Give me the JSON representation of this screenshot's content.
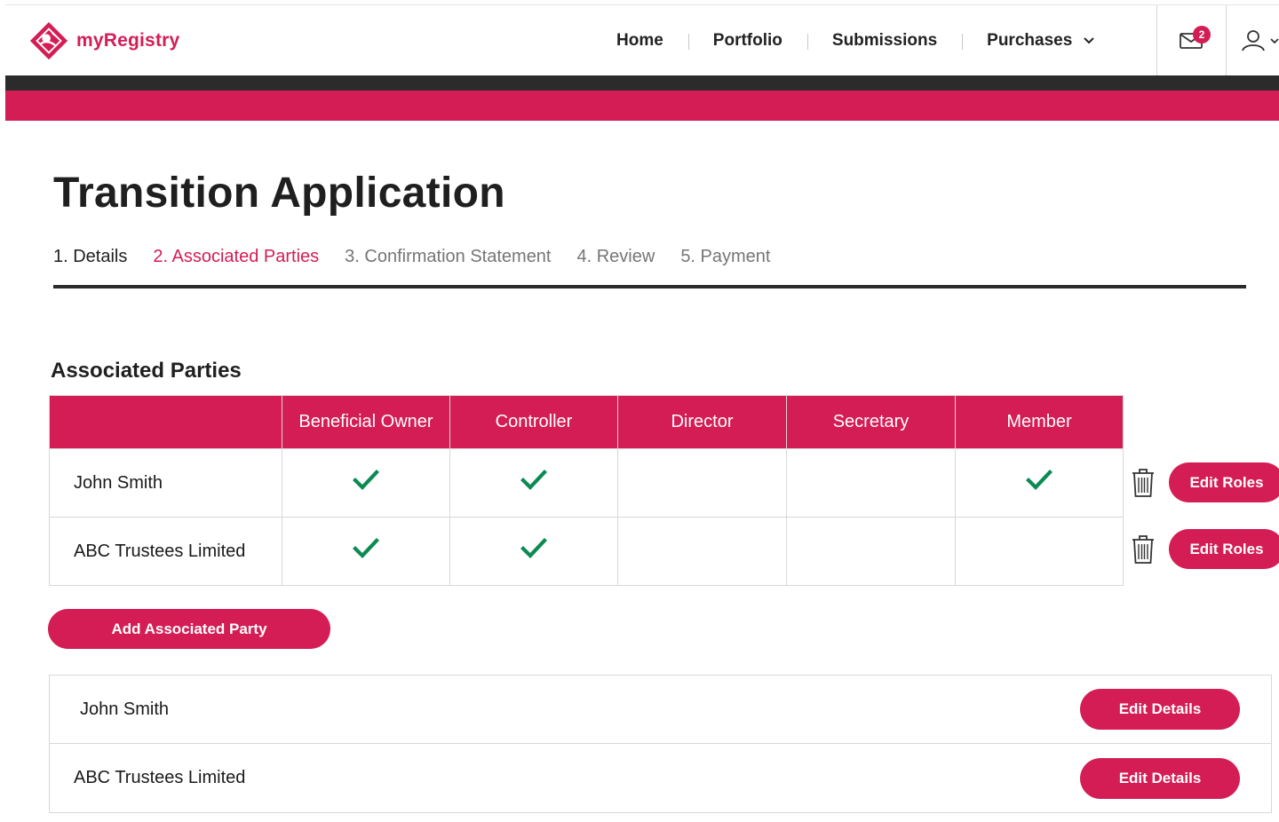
{
  "app": {
    "name": "myRegistry",
    "brand_color": "#d41d55",
    "dark_bar_color": "#2b2b2b"
  },
  "nav": {
    "items": [
      {
        "label": "Home"
      },
      {
        "label": "Portfolio"
      },
      {
        "label": "Submissions"
      },
      {
        "label": "Purchases",
        "has_dropdown": true
      }
    ],
    "mail_icon": "envelope-icon",
    "mail_count": "2",
    "user_icon": "user-icon"
  },
  "page": {
    "title": "Transition Application",
    "steps": [
      {
        "label": "1. Details",
        "state": "done"
      },
      {
        "label": "2. Associated Parties",
        "state": "current"
      },
      {
        "label": "3. Confirmation Statement",
        "state": "upcoming"
      },
      {
        "label": "4. Review",
        "state": "upcoming"
      },
      {
        "label": "5. Payment",
        "state": "upcoming"
      }
    ]
  },
  "roles_table": {
    "title": "Associated Parties",
    "columns": [
      "",
      "Beneficial Owner",
      "Controller",
      "Director",
      "Secretary",
      "Member"
    ],
    "rows": [
      {
        "name": "John Smith",
        "roles": [
          true,
          true,
          false,
          false,
          true
        ],
        "edit_label": "Edit Roles"
      },
      {
        "name": "ABC Trustees Limited",
        "roles": [
          true,
          true,
          false,
          false,
          false
        ],
        "edit_label": "Edit Roles"
      }
    ],
    "check_color": "#0b8a52",
    "delete_icon": "trash-icon"
  },
  "add_button": {
    "label": "Add Associated Party"
  },
  "details_list": [
    {
      "name": "John Smith",
      "button": "Edit Details"
    },
    {
      "name": "ABC Trustees Limited",
      "button": "Edit Details"
    }
  ]
}
